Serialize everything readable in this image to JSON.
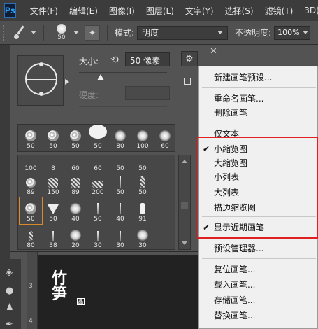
{
  "app": {
    "logo": "Ps"
  },
  "menubar": {
    "items": [
      "文件(F)",
      "编辑(E)",
      "图像(I)",
      "图层(L)",
      "文字(Y)",
      "选择(S)",
      "滤镜(T)",
      "3D("
    ]
  },
  "options": {
    "brush_size": "50",
    "mode_label": "模式:",
    "mode_value": "明度",
    "opacity_label": "不透明度:",
    "opacity_value": "100%"
  },
  "picker": {
    "size_label": "大小:",
    "size_value": "50 像素",
    "hardness_label": "硬度:",
    "top_row": [
      "50",
      "50",
      "50",
      "50",
      "80",
      "100",
      "60"
    ],
    "grid_rows": [
      [
        "100",
        "8",
        "60",
        "60",
        "50",
        "50"
      ],
      [
        "89",
        "150",
        "89",
        "200",
        "50",
        "50"
      ],
      [
        "50",
        "50",
        "40",
        "50",
        "40",
        "91"
      ],
      [
        "80",
        "38",
        "20",
        "30",
        "30",
        "30"
      ]
    ]
  },
  "menu": {
    "items": [
      "新建画笔预设...",
      "重命名画笔...",
      "删除画笔",
      "仅文本",
      "小缩览图",
      "大缩览图",
      "小列表",
      "大列表",
      "描边缩览图",
      "显示近期画笔",
      "预设管理器...",
      "复位画笔...",
      "载入画笔...",
      "存储画笔...",
      "替换画笔..."
    ],
    "check": "✔"
  },
  "ruler": {
    "marks": [
      "3",
      "4"
    ]
  },
  "artwork": {
    "glyph_top": "竹",
    "glyph_bottom": "笋",
    "tag": "品"
  },
  "colors": {
    "highlight": "#e02020",
    "menu_bg": "#f0f0f0",
    "ui_dark": "#3c3c3c"
  }
}
